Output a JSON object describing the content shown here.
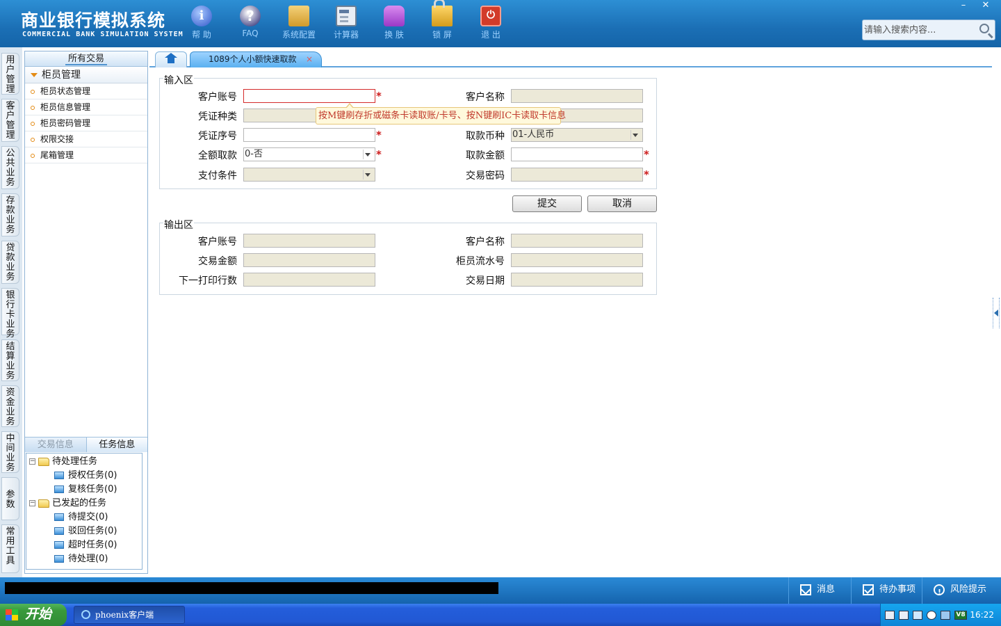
{
  "app": {
    "title_cn": "商业银行模拟系统",
    "title_en": "COMMERCIAL BANK SIMULATION SYSTEM"
  },
  "toolbar": [
    {
      "id": "help",
      "label": "帮 助",
      "icon": "help-icon",
      "glyph": "i"
    },
    {
      "id": "faq",
      "label": "FAQ",
      "icon": "faq-icon",
      "glyph": "?"
    },
    {
      "id": "config",
      "label": "系统配置",
      "icon": "toolbox-icon",
      "glyph": ""
    },
    {
      "id": "calc",
      "label": "计算器",
      "icon": "calculator-icon",
      "glyph": ""
    },
    {
      "id": "skin",
      "label": "换 肤",
      "icon": "shirt-icon",
      "glyph": ""
    },
    {
      "id": "lock",
      "label": "锁 屏",
      "icon": "lock-icon",
      "glyph": ""
    },
    {
      "id": "exit",
      "label": "退 出",
      "icon": "power-icon",
      "glyph": "⏻"
    }
  ],
  "window_controls": {
    "minimize": "–",
    "close": "✕"
  },
  "search": {
    "placeholder": "请输入搜索内容...",
    "value": ""
  },
  "categories": [
    "用户管理",
    "客户管理",
    "公共业务",
    "存款业务",
    "贷款业务",
    "银行卡业务",
    "结算业务",
    "资金业务",
    "中间业务",
    "参数",
    "常用工具"
  ],
  "sidebar": {
    "header": "所有交易",
    "group": "柜员管理",
    "items": [
      "柜员状态管理",
      "柜员信息管理",
      "柜员密码管理",
      "权限交接",
      "尾箱管理"
    ]
  },
  "task_panel": {
    "tabs": [
      "交易信息",
      "任务信息"
    ],
    "tree": [
      {
        "label": "待处理任务",
        "level": 0,
        "type": "folder",
        "toggle": "−"
      },
      {
        "label": "授权任务(0)",
        "level": 1,
        "type": "leaf"
      },
      {
        "label": "复核任务(0)",
        "level": 1,
        "type": "leaf"
      },
      {
        "label": "已发起的任务",
        "level": 0,
        "type": "folder",
        "toggle": "−"
      },
      {
        "label": "待提交(0)",
        "level": 1,
        "type": "leaf"
      },
      {
        "label": "驳回任务(0)",
        "level": 1,
        "type": "leaf"
      },
      {
        "label": "超时任务(0)",
        "level": 1,
        "type": "leaf"
      },
      {
        "label": "待处理(0)",
        "level": 1,
        "type": "leaf"
      }
    ]
  },
  "tabs": {
    "active": "1089个人小额快速取款",
    "close": "×"
  },
  "input_area": {
    "title": "输入区",
    "fields": {
      "customer_account": {
        "label": "客户账号",
        "value": "",
        "required": true
      },
      "customer_name": {
        "label": "客户名称",
        "value": ""
      },
      "voucher_type": {
        "label": "凭证种类",
        "value": ""
      },
      "voucher_no": {
        "label": "凭证序号",
        "value": "",
        "required": true
      },
      "currency": {
        "label": "取款币种",
        "value": "01-人民币"
      },
      "full_withdraw": {
        "label": "全额取款",
        "value": "0-否",
        "required": true
      },
      "amount": {
        "label": "取款金额",
        "value": "",
        "required": true
      },
      "pay_condition": {
        "label": "支付条件",
        "value": ""
      },
      "password": {
        "label": "交易密码",
        "value": "",
        "required": true
      }
    },
    "tooltip": "按M键刷存折或磁条卡读取账/卡号、按N键刷IC卡读取卡信息",
    "required_mark": "*"
  },
  "buttons": {
    "submit": "提交",
    "cancel": "取消"
  },
  "output_area": {
    "title": "输出区",
    "fields": {
      "customer_account": {
        "label": "客户账号",
        "value": ""
      },
      "customer_name": {
        "label": "客户名称",
        "value": ""
      },
      "trans_amount": {
        "label": "交易金额",
        "value": ""
      },
      "teller_serial": {
        "label": "柜员流水号",
        "value": ""
      },
      "next_print_line": {
        "label": "下一打印行数",
        "value": ""
      },
      "trans_date": {
        "label": "交易日期",
        "value": ""
      }
    }
  },
  "statusbar": {
    "message": "消息",
    "todo": "待办事项",
    "risk": "风险提示"
  },
  "taskbar": {
    "start": "开始",
    "task_item": "phoenix客户端",
    "clock": "16:22",
    "tray_badge": "V8"
  }
}
